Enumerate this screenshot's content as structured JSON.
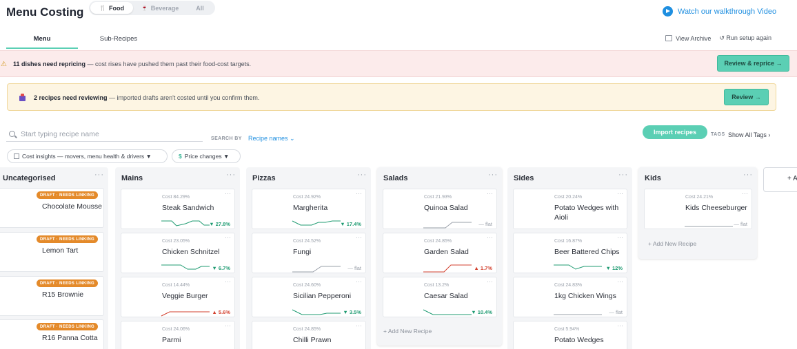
{
  "header": {
    "title": "Menu Costing",
    "segments": [
      {
        "icon": "fork-knife-icon",
        "glyph": "🍴",
        "label": "Food"
      },
      {
        "icon": "wine-glass-icon",
        "glyph": "🍷",
        "label": "Beverage"
      },
      {
        "label": "All"
      }
    ],
    "walkthrough": "Watch our walkthrough Video"
  },
  "tabs": [
    "Menu",
    "Sub-Recipes"
  ],
  "tools": {
    "archive": "View Archive",
    "setup": "↺ Run setup again"
  },
  "banners": {
    "reprice": {
      "bold": "11 dishes need repricing",
      "text": " — cost rises have pushed them past their food-cost targets.",
      "button": "Review & reprice →"
    },
    "review": {
      "bold": "2 recipes need reviewing",
      "text": " — imported drafts aren't costed until you confirm them.",
      "button": "Review →"
    }
  },
  "search": {
    "placeholder": "Start typing recipe name",
    "by_label": "SEARCH BY",
    "by_value": "Recipe names ⌄"
  },
  "import_button": "Import recipes",
  "tags": {
    "label": "TAGS",
    "show": "Show All Tags ›"
  },
  "filters": {
    "insights": "Cost insights — movers, menu health & drivers ▼",
    "price": "Price changes ▼"
  },
  "colors": {
    "accent": "#5bcfb4",
    "down": "#1f9b72",
    "up": "#d3412f",
    "flat": "#9aa0aa",
    "draft": "#e48a2a"
  },
  "columns": [
    {
      "title": "Uncategorised",
      "dots": "···",
      "cards": [
        {
          "badge": "DRAFT · NEEDS LINKING",
          "name": "Chocolate Mousse"
        },
        {
          "badge": "DRAFT · NEEDS LINKING",
          "name": "Lemon Tart"
        },
        {
          "badge": "DRAFT · NEEDS LINKING",
          "name": "R15 Brownie"
        },
        {
          "badge": "DRAFT · NEEDS LINKING",
          "name": "R16 Panna Cotta"
        }
      ]
    },
    {
      "title": "Mains",
      "dots": "···",
      "cards": [
        {
          "cost": "Cost 84.29%",
          "name": "Steak Sandwich",
          "change": "▼ 27.8%",
          "trend": "down"
        },
        {
          "cost": "Cost 23.05%",
          "name": "Chicken Schnitzel",
          "change": "▼ 6.7%",
          "trend": "down"
        },
        {
          "cost": "Cost 14.44%",
          "name": "Veggie Burger",
          "change": "▲ 5.6%",
          "trend": "up"
        },
        {
          "cost": "Cost 24.06%",
          "name": "Parmi"
        }
      ]
    },
    {
      "title": "Pizzas",
      "dots": "···",
      "cards": [
        {
          "cost": "Cost 24.92%",
          "name": "Margherita",
          "change": "▼ 17.4%",
          "trend": "down"
        },
        {
          "cost": "Cost 24.52%",
          "name": "Fungi",
          "change": "— flat",
          "trend": "flat"
        },
        {
          "cost": "Cost 24.60%",
          "name": "Sicilian Pepperoni",
          "change": "▼ 3.5%",
          "trend": "down"
        },
        {
          "cost": "Cost 24.85%",
          "name": "Chilli Prawn"
        }
      ]
    },
    {
      "title": "Salads",
      "dots": "···",
      "cards": [
        {
          "cost": "Cost 21.93%",
          "name": "Quinoa Salad",
          "change": "— flat",
          "trend": "flat"
        },
        {
          "cost": "Cost 24.85%",
          "name": "Garden Salad",
          "change": "▲ 1.7%",
          "trend": "up"
        },
        {
          "cost": "Cost 13.2%",
          "name": "Caesar Salad",
          "change": "▼ 10.4%",
          "trend": "down"
        }
      ],
      "add": "+ Add New Recipe"
    },
    {
      "title": "Sides",
      "dots": "···",
      "cards": [
        {
          "cost": "Cost 20.24%",
          "name": "Potato Wedges with Aioli"
        },
        {
          "cost": "Cost 16.87%",
          "name": "Beer Battered Chips",
          "change": "▼ 12%",
          "trend": "down"
        },
        {
          "cost": "Cost 24.83%",
          "name": "1kg Chicken Wings",
          "change": "— flat",
          "trend": "flat"
        },
        {
          "cost": "Cost 5.94%",
          "name": "Potato Wedges"
        }
      ]
    },
    {
      "title": "Kids",
      "dots": "···",
      "cards": [
        {
          "cost": "Cost 24.21%",
          "name": "Kids Cheeseburger",
          "change": "— flat",
          "trend": "flat"
        }
      ],
      "add": "+ Add New Recipe"
    }
  ],
  "add_column": "+ A"
}
